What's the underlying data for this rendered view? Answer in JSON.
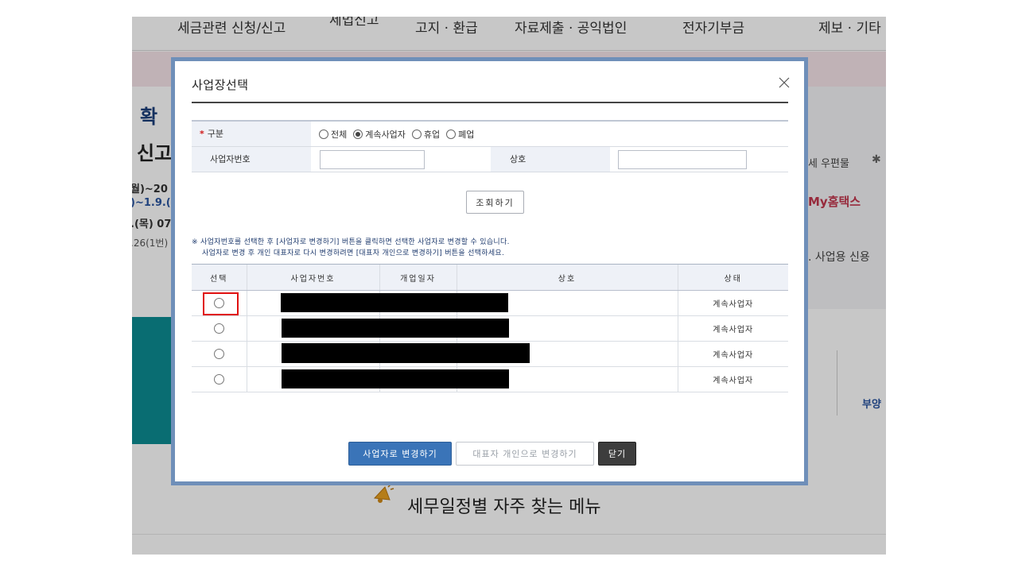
{
  "background": {
    "nav": [
      "세금관련 신청/신고",
      "세법신고",
      "고지 · 환급",
      "자료제출 · 공익법인",
      "전자기부금",
      "제보 · 기타"
    ],
    "left_fragments": [
      "확",
      "신고",
      "월)~20",
      ")~1.9.(",
      ".(목) 07",
      ".26(1번)"
    ],
    "right_fragments": [
      "세 우편물",
      "My홈택스",
      ". 사업용 신용",
      "부양"
    ],
    "bottom_heading": "세무일정별 자주 찾는 메뉴"
  },
  "modal": {
    "title": "사업장선택",
    "close_icon": "close-icon",
    "search": {
      "category_label": "구분",
      "required_mark": "*",
      "options": [
        {
          "label": "전체",
          "checked": false
        },
        {
          "label": "계속사업자",
          "checked": true
        },
        {
          "label": "휴업",
          "checked": false
        },
        {
          "label": "폐업",
          "checked": false
        }
      ],
      "bizno_label": "사업자번호",
      "bizno_value": "",
      "name_label": "상호",
      "name_value": ""
    },
    "search_button": "조회하기",
    "notice_line1": "※ 사업자번호를 선택한 후 [사업자로 변경하기] 버튼을 클릭하면 선택한 사업자로 변경할 수 있습니다.",
    "notice_line2": "사업자로 변경 후 개인 대표자로 다시 변경하려면 [대표자 개인으로 변경하기] 버튼을 선택하세요.",
    "table": {
      "headers": [
        "선택",
        "사업자번호",
        "개업일자",
        "상호",
        "상태"
      ],
      "rows": [
        {
          "status": "계속사업자"
        },
        {
          "status": "계속사업자"
        },
        {
          "status": "계속사업자"
        },
        {
          "status": "계속사업자"
        }
      ]
    },
    "buttons": {
      "change": "사업자로 변경하기",
      "representative": "대표자 개인으로 변경하기",
      "close": "닫기"
    }
  },
  "colors": {
    "primary_button": "#3a74b8",
    "modal_border": "#6f8fb9",
    "highlight": "#e01010",
    "required": "#d01818"
  }
}
